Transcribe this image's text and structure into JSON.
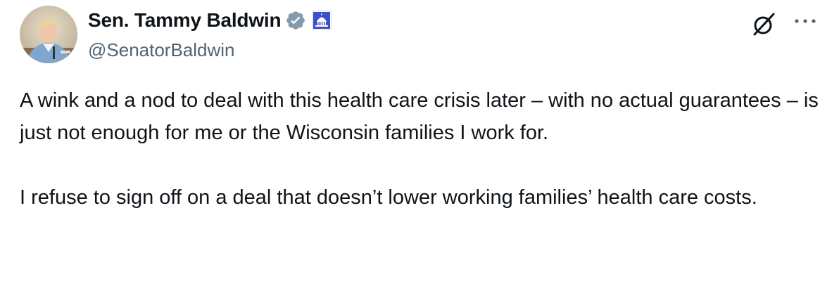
{
  "author": {
    "display_name": "Sen. Tammy Baldwin",
    "handle": "@SenatorBaldwin",
    "avatar_icon": "profile-photo",
    "verified_icon": "verified-badge-icon",
    "affiliation_icon": "us-capitol-icon"
  },
  "actions": {
    "grok_icon": "grok-icon",
    "more_icon": "more-dots-icon"
  },
  "tweet": {
    "paragraph_1": "A wink and a nod to deal with this health care crisis later – with no actual guarantees – is just not enough for me or the Wisconsin families I work for.",
    "paragraph_2": "I refuse to sign off on a deal that doesn’t lower working families’ health care costs."
  },
  "colors": {
    "text_primary": "#0f1419",
    "text_secondary": "#536471",
    "verified_gray": "#829aab",
    "capitol_blue": "#3b4fc8"
  }
}
